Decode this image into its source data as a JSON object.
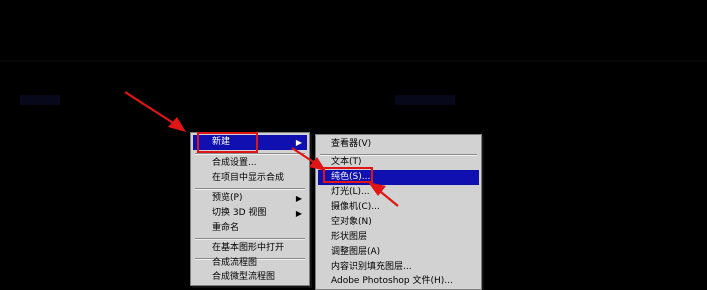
{
  "context_menu": {
    "items": [
      {
        "label": "新建",
        "has_submenu": true,
        "highlighted": true
      },
      {
        "label": "合成设置..."
      },
      {
        "label": "在项目中显示合成"
      },
      {
        "label": "预览(P)",
        "has_submenu": true
      },
      {
        "label": "切换 3D 视图",
        "has_submenu": true
      },
      {
        "label": "重命名"
      },
      {
        "label": "在基本图形中打开"
      },
      {
        "label": "合成流程图"
      },
      {
        "label": "合成微型流程图"
      }
    ]
  },
  "submenu": {
    "items": [
      {
        "label": "查看器(V)"
      },
      {
        "label": "文本(T)"
      },
      {
        "label": "纯色(S)...",
        "highlighted": true
      },
      {
        "label": "灯光(L)..."
      },
      {
        "label": "摄像机(C)..."
      },
      {
        "label": "空对象(N)"
      },
      {
        "label": "形状图层"
      },
      {
        "label": "调整图层(A)"
      },
      {
        "label": "内容识别填充图层..."
      },
      {
        "label": "Adobe Photoshop 文件(H)..."
      }
    ]
  },
  "colors": {
    "highlight": "#1010b0",
    "annotation": "#e01515",
    "menu_bg": "#d2d2d2"
  },
  "icons": {
    "submenu_arrow": "chevron-right-icon"
  }
}
